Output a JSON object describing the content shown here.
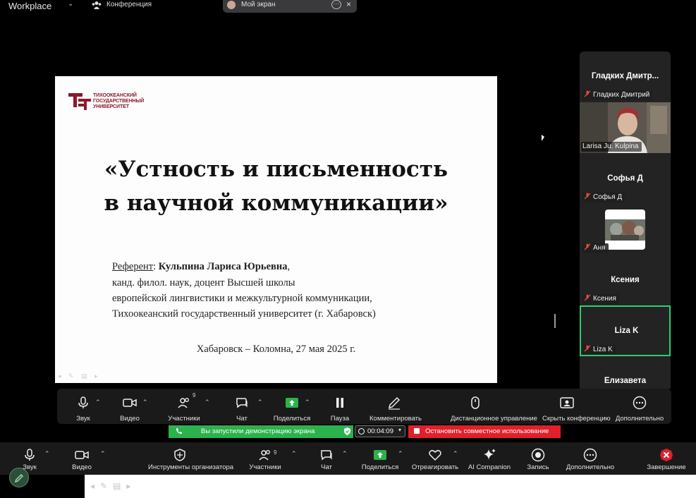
{
  "topbar": {
    "app_title": "Workplace",
    "conference_label": "Конференция",
    "my_screen_label": "Мой экран"
  },
  "slide": {
    "logo_text": "ТИХООКЕАНСКИЙ\nГОСУДАРСТВЕННЫЙ\nУНИВЕРСИТЕТ",
    "title_line1": "«Устность и письменность",
    "title_line2": "в научной коммуникации»",
    "referent_label": "Референт",
    "referent_separator": ": ",
    "referent_name": "Кульпина Лариса Юрьевна",
    "referent_tail": ",",
    "line2": "канд. филол. наук,  доцент Высшей школы",
    "line3": "европейской лингвистики и межкультурной коммуникации,",
    "line4": "Тихоокеанский государственный университет (г. Хабаровск)",
    "place_date": "Хабаровск – Коломна, 27 мая 2025 г."
  },
  "participants": [
    {
      "name": "Гладких  Дмитр...",
      "label": "Гладких Дмитрий"
    },
    {
      "label": "Larisa Ju. Kulpina"
    },
    {
      "name": "Софья Д",
      "label": "Софья Д"
    },
    {
      "label": "Аня"
    },
    {
      "name": "Ксения",
      "label": "Ксения"
    },
    {
      "name": "Liza K",
      "label": "Liza K"
    },
    {
      "name": "Елизавета"
    }
  ],
  "inner_toolbar": {
    "audio": "Звук",
    "video": "Видео",
    "participants": "Участники",
    "participants_count": "9",
    "chat": "Чат",
    "share": "Поделиться",
    "pause": "Пауза",
    "annotate": "Комментировать",
    "remote_control": "Дистанционное управление",
    "hide_conference": "Скрыть конференцию",
    "more": "Дополнительно"
  },
  "status": {
    "sharing_notice": "Вы запустили демонстрацию экрана",
    "timer": "00:04:09",
    "stop_sharing": "Остановить совместное использование"
  },
  "main_toolbar": {
    "audio": "Звук",
    "video": "Видео",
    "host_tools": "Инструменты организатора",
    "participants": "Участники",
    "participants_count": "9",
    "chat": "Чат",
    "share": "Поделиться",
    "react": "Отреагировать",
    "ai_companion": "AI Companion",
    "record": "Запись",
    "more": "Дополнительно",
    "end": "Завершение"
  },
  "colors": {
    "share_green": "#2bb24c",
    "stop_red": "#e0202a",
    "active_speaker_border": "#2ecc71",
    "logo_maroon": "#8b1a2a"
  }
}
